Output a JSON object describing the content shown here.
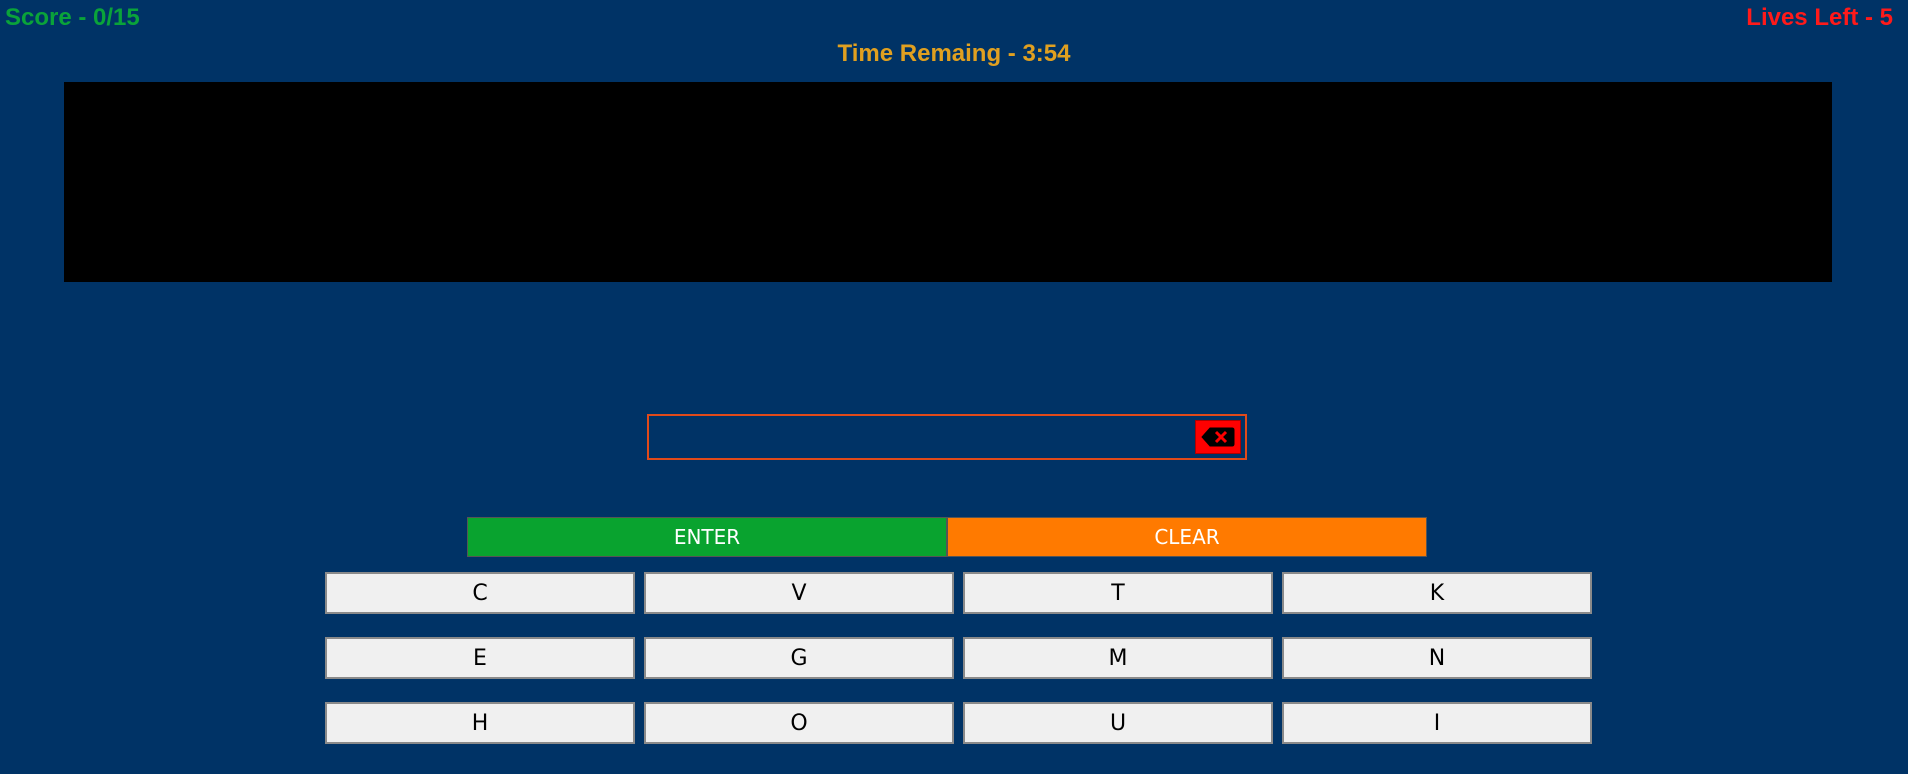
{
  "header": {
    "score": "Score - 0/15",
    "timer": "Time Remaing - 3:54",
    "lives": "Lives Left - 5"
  },
  "answer": {
    "value": ""
  },
  "colors": {
    "background": "#003366",
    "score": "#0aa33a",
    "lives": "#ff1a1a",
    "timer": "#e0a020",
    "enter": "#09a32f",
    "clear": "#ff7a00",
    "backspace": "#ff0000"
  },
  "actions": {
    "enter_label": "ENTER",
    "clear_label": "CLEAR",
    "backspace_icon": "backspace-icon"
  },
  "letters": [
    "C",
    "V",
    "T",
    "K",
    "E",
    "G",
    "M",
    "N",
    "H",
    "O",
    "U",
    "I"
  ]
}
